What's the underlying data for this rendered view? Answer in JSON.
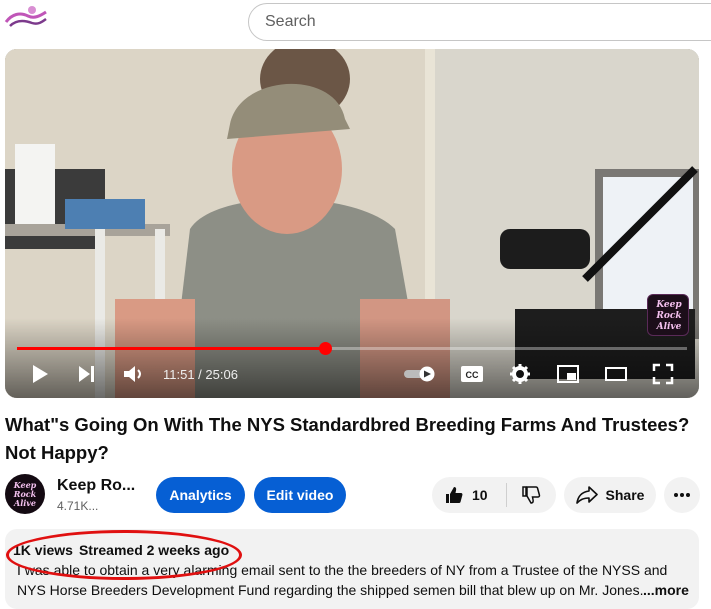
{
  "search": {
    "placeholder": "Search"
  },
  "player": {
    "progress_fraction": 0.46,
    "current_time": "11:51",
    "duration": "25:06",
    "time_display": "11:51 / 25:06",
    "watermark_lines": [
      "Keep",
      "Rock",
      "Alive"
    ]
  },
  "video": {
    "title": "What\"s Going On With The NYS Standardbred Breeding Farms And Trustees? Not Happy?"
  },
  "channel": {
    "name": "Keep Ro...",
    "subscribers": "4.71K...",
    "avatar_lines": [
      "Keep",
      "Rock",
      "Alive"
    ]
  },
  "actions": {
    "analytics_label": "Analytics",
    "edit_label": "Edit video",
    "like_count": "10",
    "share_label": "Share"
  },
  "description": {
    "views": "1K views",
    "streamed": "Streamed 2 weeks ago",
    "line1": "I was able to obtain a very alarming email sent to the the breeders of NY from a Trustee of the NYSS and",
    "line2": "NYS Horse Breeders Development Fund regarding the shipped semen bill that blew up on Mr. Jones.",
    "more_label": "...more"
  },
  "colors": {
    "accent_blue": "#065fd4",
    "progress_red": "#ff0000",
    "annotation_red": "#e01010"
  }
}
